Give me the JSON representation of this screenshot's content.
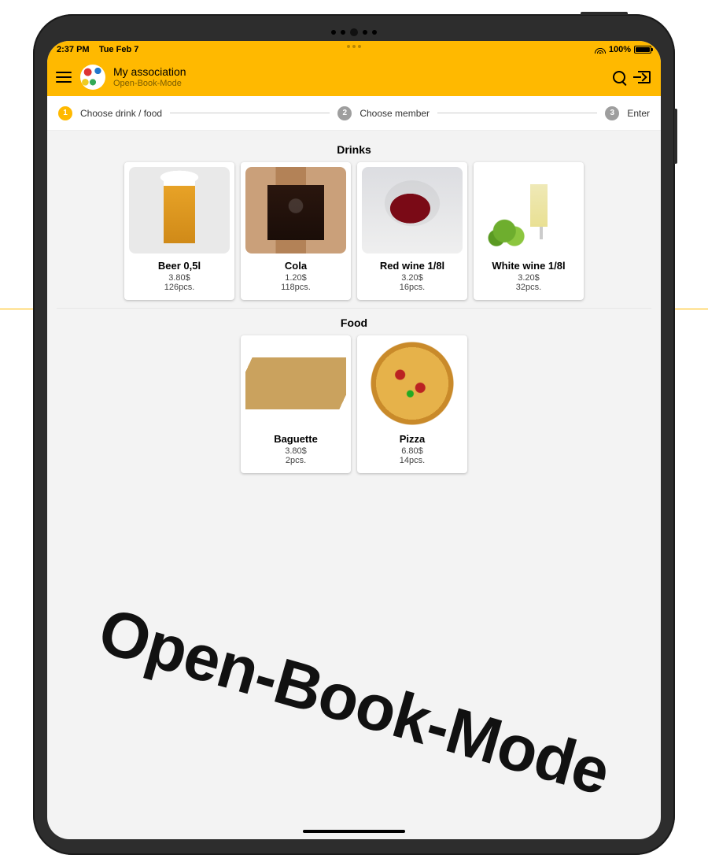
{
  "status": {
    "time": "2:37 PM",
    "date": "Tue Feb 7",
    "battery": "100%"
  },
  "header": {
    "title": "My association",
    "subtitle": "Open-Book-Mode"
  },
  "stepper": {
    "step1": "Choose drink / food",
    "step2": "Choose member",
    "step3": "Enter"
  },
  "sections": {
    "drinks": {
      "title": "Drinks",
      "items": [
        {
          "name": "Beer 0,5l",
          "price": "3.80$",
          "stock": "126pcs."
        },
        {
          "name": "Cola",
          "price": "1.20$",
          "stock": "118pcs."
        },
        {
          "name": "Red wine 1/8l",
          "price": "3.20$",
          "stock": "16pcs."
        },
        {
          "name": "White wine 1/8l",
          "price": "3.20$",
          "stock": "32pcs."
        }
      ]
    },
    "food": {
      "title": "Food",
      "items": [
        {
          "name": "Baguette",
          "price": "3.80$",
          "stock": "2pcs."
        },
        {
          "name": "Pizza",
          "price": "6.80$",
          "stock": "14pcs."
        }
      ]
    }
  },
  "overlay": "Open-Book-Mode"
}
